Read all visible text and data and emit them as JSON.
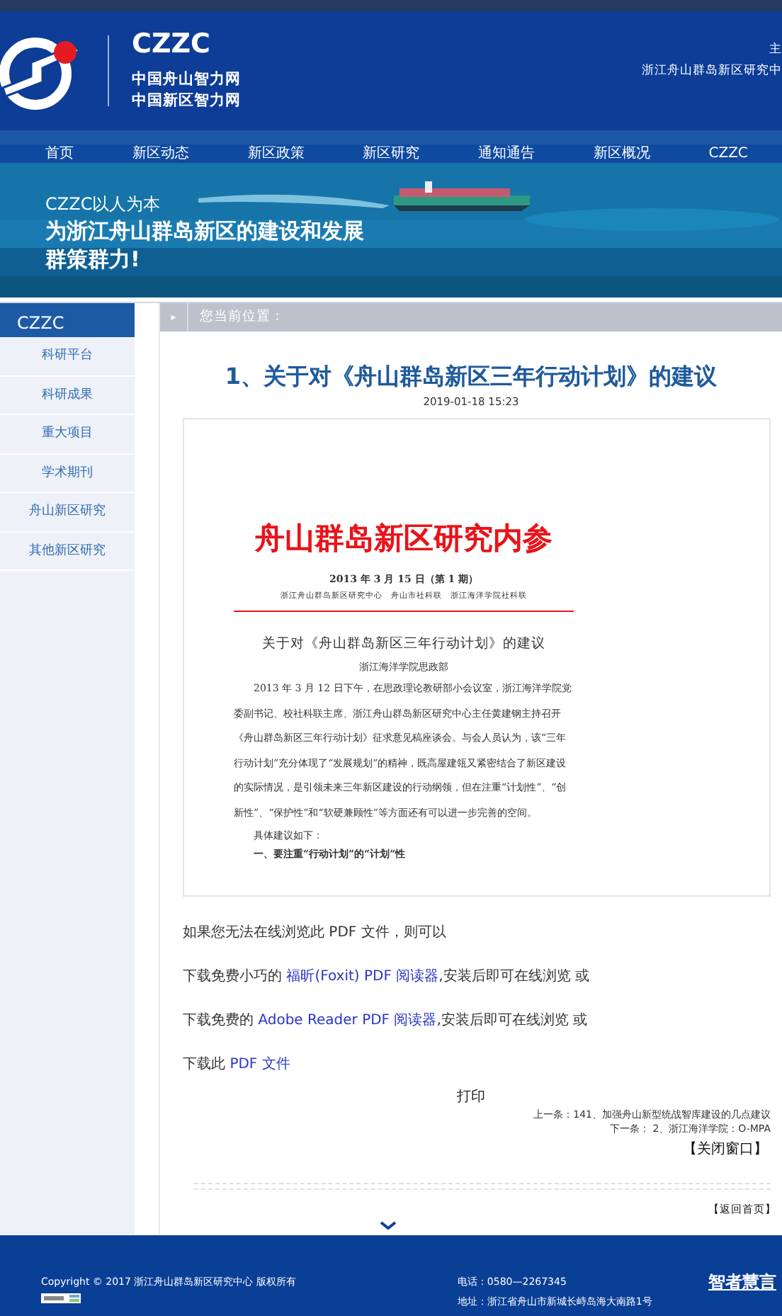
{
  "header": {
    "brand": "CZZC",
    "site_names": [
      "中国舟山智力网",
      "中国新区智力网"
    ],
    "top_right": [
      "主",
      "浙江舟山群岛新区研究中"
    ]
  },
  "nav": [
    {
      "label": "首页"
    },
    {
      "label": "新区动态"
    },
    {
      "label": "新区政策"
    },
    {
      "label": "新区研究"
    },
    {
      "label": "通知通告"
    },
    {
      "label": "新区概况"
    },
    {
      "label": "CZZC"
    }
  ],
  "banner": {
    "kind": "picture",
    "lines": [
      "CZZC以人为本",
      "为浙江舟山群岛新区的建设和发展",
      "群策群力!"
    ]
  },
  "sidebar": {
    "title": "CZZC",
    "items": [
      {
        "label": "科研平台"
      },
      {
        "label": "科研成果"
      },
      {
        "label": "重大项目"
      },
      {
        "label": "学术期刊"
      },
      {
        "label": "舟山新区研究"
      },
      {
        "label": "其他新区研究"
      }
    ]
  },
  "breadcrumb": {
    "marker": "▸",
    "label": "您当前位置："
  },
  "article": {
    "title": "1、关于对《舟山群岛新区三年行动计划》的建议",
    "date": "2019-01-18 15:23",
    "document": {
      "masthead": "舟山群岛新区研究内参",
      "issue": "2013 年 3 月 15 日（第 1 期）",
      "publishers": "浙江舟山群岛新区研究中心　舟山市社科联　浙江海洋学院社科联",
      "title": "关于对《舟山群岛新区三年行动计划》的建议",
      "author": "浙江海洋学院思政部",
      "body": "2013 年 3 月 12 日下午，在思政理论教研部小会议室，浙江海洋学院党委副书记、校社科联主席、浙江舟山群岛新区研究中心主任黄建钢主持召开《舟山群岛新区三年行动计划》征求意见稿座谈会。与会人员认为，该“三年行动计划”充分体现了“发展规划”的精神，既高屋建瓴又紧密结合了新区建设的实际情况，是引领未来三年新区建设的行动纲领，但在注重“计划性”、“创新性”、“保护性”和“软硬兼顾性”等方面还有可以进一步完善的空间。",
      "lead": "具体建议如下：",
      "heading": "一、要注重“行动计划”的“计划”性"
    },
    "help_lines": [
      {
        "before": "如果您无法在线浏览此 PDF 文件，则可以"
      },
      {
        "before": "下载免费小巧的 ",
        "link": "福昕(Foxit) PDF 阅读器",
        "after": ",安装后即可在线浏览   或"
      },
      {
        "before": "下载免费的 ",
        "link": "Adobe Reader PDF 阅读器",
        "after": ",安装后即可在线浏览   或"
      },
      {
        "before": "下载此 ",
        "link": "PDF 文件"
      }
    ],
    "print": "打印",
    "prev": "上一条：141、加强舟山新型统战智库建设的几点建议",
    "next": "下一条： 2、浙江海洋学院：O-MPA",
    "close": "【关闭窗口】",
    "home": "【返回首页】"
  },
  "footer": {
    "copyright": "Copyright © 2017 浙江舟山群岛新区研究中心 版权所有",
    "phone": "电话：0580—2267345",
    "address": "地址：浙江省舟山市新城长峙岛海大南路1号",
    "slogan": "智者慧言"
  }
}
